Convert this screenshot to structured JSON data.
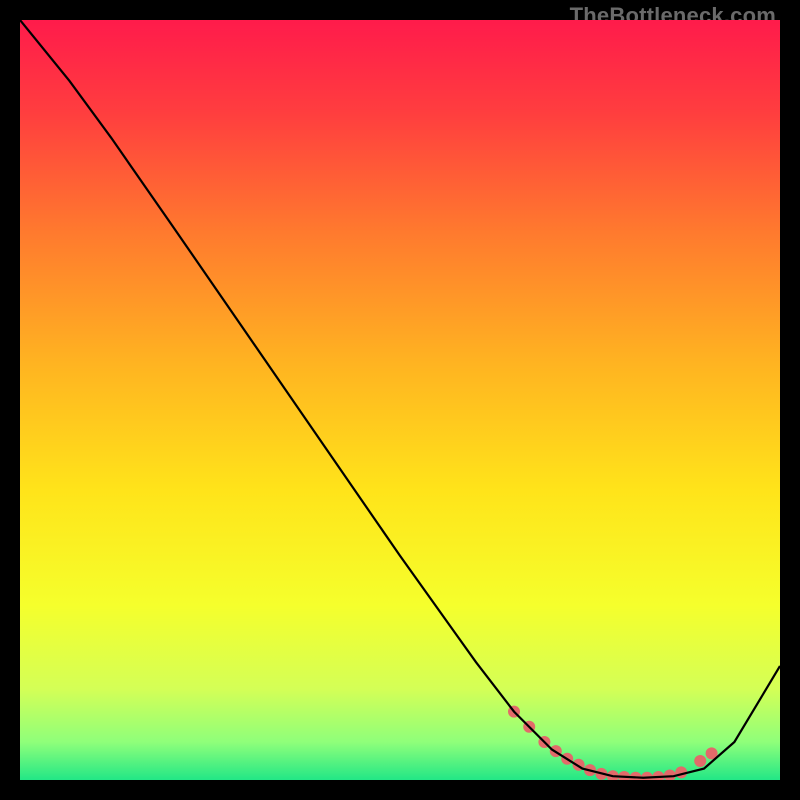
{
  "watermark": "TheBottleneck.com",
  "chart_data": {
    "type": "line",
    "title": "",
    "xlabel": "",
    "ylabel": "",
    "xlim": [
      0,
      100
    ],
    "ylim": [
      0,
      100
    ],
    "grid": false,
    "background_gradient": {
      "stops": [
        {
          "pos": 0.0,
          "color": "#ff1b4b"
        },
        {
          "pos": 0.12,
          "color": "#ff3d3f"
        },
        {
          "pos": 0.28,
          "color": "#ff7a2e"
        },
        {
          "pos": 0.45,
          "color": "#ffb321"
        },
        {
          "pos": 0.62,
          "color": "#ffe41a"
        },
        {
          "pos": 0.77,
          "color": "#f5ff2c"
        },
        {
          "pos": 0.88,
          "color": "#d4ff56"
        },
        {
          "pos": 0.95,
          "color": "#8fff7a"
        },
        {
          "pos": 1.0,
          "color": "#22e786"
        }
      ]
    },
    "series": [
      {
        "name": "bottleneck-curve",
        "color": "#000000",
        "x": [
          0.0,
          6.5,
          12.0,
          20.0,
          30.0,
          40.0,
          50.0,
          60.0,
          65.0,
          70.0,
          74.0,
          78.0,
          82.0,
          86.0,
          90.0,
          94.0,
          100.0
        ],
        "y": [
          100.0,
          92.0,
          84.5,
          73.0,
          58.5,
          44.0,
          29.5,
          15.5,
          9.0,
          4.0,
          1.5,
          0.5,
          0.3,
          0.5,
          1.5,
          5.0,
          15.0
        ]
      }
    ],
    "markers": {
      "name": "highlight-dots",
      "color": "#e26a6a",
      "radius": 6,
      "x": [
        65.0,
        67.0,
        69.0,
        70.5,
        72.0,
        73.5,
        75.0,
        76.5,
        78.0,
        79.5,
        81.0,
        82.5,
        84.0,
        85.5,
        87.0,
        89.5,
        91.0
      ],
      "y": [
        9.0,
        7.0,
        5.0,
        3.8,
        2.8,
        2.0,
        1.3,
        0.8,
        0.5,
        0.4,
        0.3,
        0.3,
        0.4,
        0.6,
        1.0,
        2.5,
        3.5
      ]
    }
  }
}
